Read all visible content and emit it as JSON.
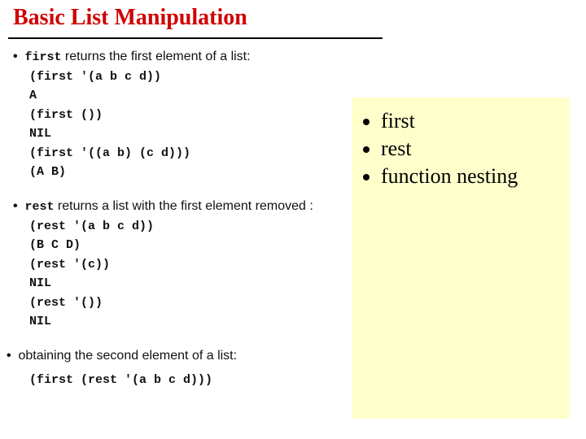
{
  "bg": {
    "title": "Basic List Manipulation",
    "lines": [
      {
        "type": "bullet",
        "first": true,
        "parts": [
          {
            "cls": "mono",
            "t": "first"
          },
          {
            "cls": "sans",
            "t": " returns the first element of a list:"
          }
        ]
      },
      {
        "type": "code",
        "t": "(first '(a b c d))"
      },
      {
        "type": "code",
        "t": "A"
      },
      {
        "type": "code",
        "t": "(first ())"
      },
      {
        "type": "code",
        "t": "NIL"
      },
      {
        "type": "code",
        "t": "(first '((a b) (c d)))"
      },
      {
        "type": "code",
        "t": "(A B)"
      },
      {
        "type": "spacer"
      },
      {
        "type": "bullet",
        "parts": [
          {
            "cls": "mono",
            "t": "rest"
          },
          {
            "cls": "sans",
            "t": " returns a list with the first element removed :"
          }
        ]
      },
      {
        "type": "code",
        "t": "(rest '(a b c d))"
      },
      {
        "type": "code",
        "t": "(B C D)"
      },
      {
        "type": "code",
        "t": "(rest '(c))"
      },
      {
        "type": "code",
        "t": "NIL"
      },
      {
        "type": "code",
        "t": "(rest '())"
      },
      {
        "type": "code",
        "t": "NIL"
      },
      {
        "type": "spacer"
      },
      {
        "type": "bullet",
        "parts": [
          {
            "cls": "sans",
            "t": "obtaining the second element of a list:"
          }
        ]
      },
      {
        "type": "spacer"
      },
      {
        "type": "code",
        "t": "(first (rest '(a b c d)))"
      }
    ]
  },
  "overlay": {
    "items": [
      "first",
      "rest",
      "function nesting"
    ]
  }
}
